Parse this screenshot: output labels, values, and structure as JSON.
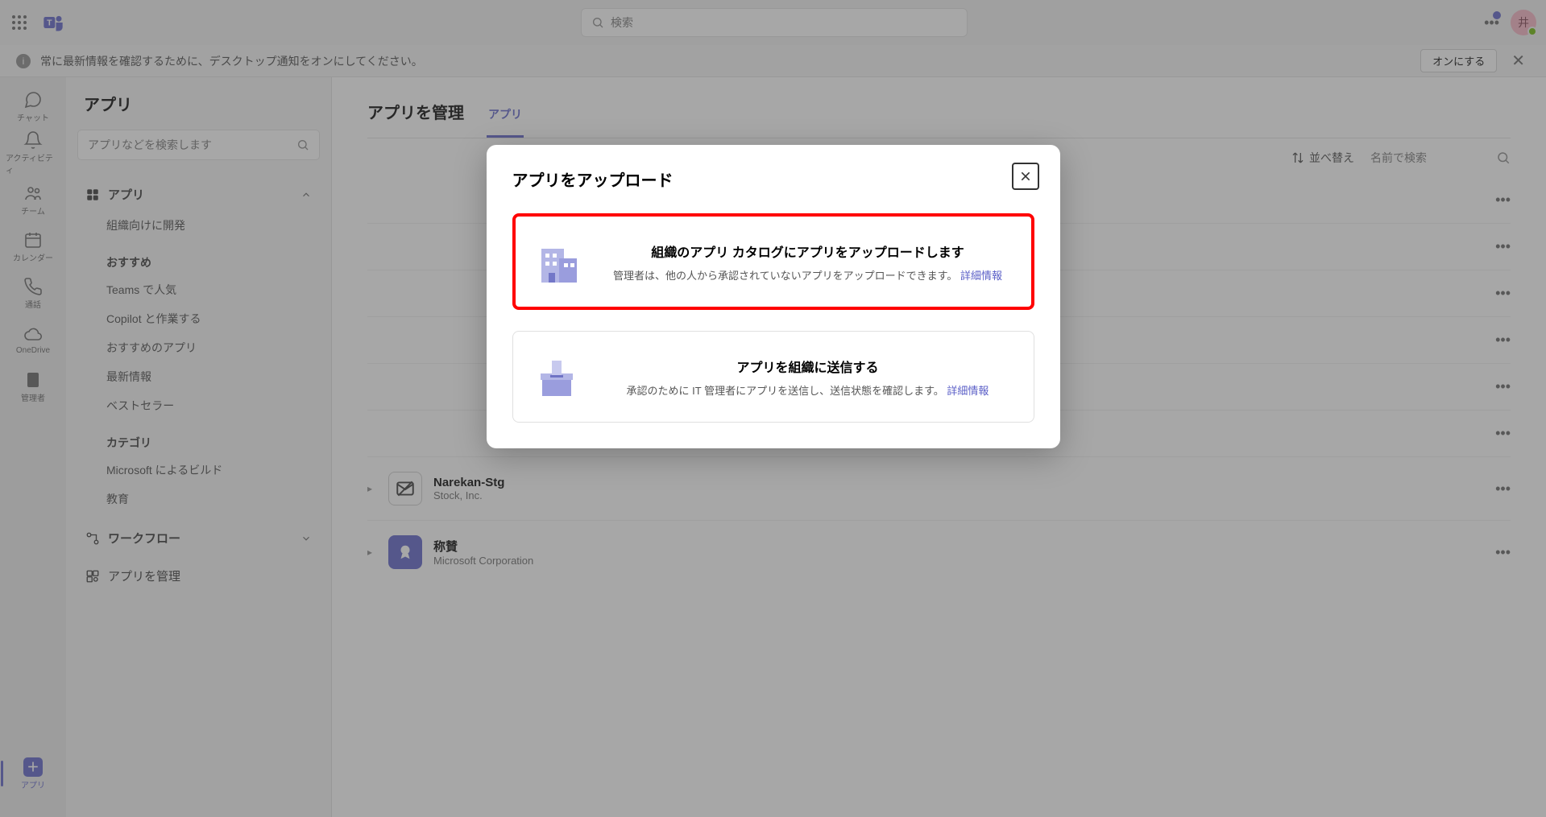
{
  "topbar": {
    "search_placeholder": "検索",
    "avatar_initial": "井"
  },
  "banner": {
    "text": "常に最新情報を確認するために、デスクトップ通知をオンにしてください。",
    "button": "オンにする"
  },
  "rail": {
    "items": [
      {
        "label": "チャット"
      },
      {
        "label": "アクティビティ"
      },
      {
        "label": "チーム"
      },
      {
        "label": "カレンダー"
      },
      {
        "label": "通話"
      },
      {
        "label": "OneDrive"
      },
      {
        "label": "管理者"
      },
      {
        "label": "アプリ"
      }
    ]
  },
  "sidepanel": {
    "title": "アプリ",
    "search_placeholder": "アプリなどを検索します",
    "group_apps": "アプリ",
    "dev_for_org": "組織向けに開発",
    "section_recommended": "おすすめ",
    "rec": [
      "Teams で人気",
      "Copilot と作業する",
      "おすすめのアプリ",
      "最新情報",
      "ベストセラー"
    ],
    "section_category": "カテゴリ",
    "cat": [
      "Microsoft によるビルド",
      "教育"
    ],
    "group_workflow": "ワークフロー",
    "manage_apps": "アプリを管理"
  },
  "content": {
    "title": "アプリを管理",
    "tab": "アプリ",
    "sort_label": "並べ替え",
    "filter_placeholder": "名前で検索",
    "apps": [
      {
        "name": "Narekan-Stg",
        "publisher": "Stock, Inc."
      },
      {
        "name": "称賛",
        "publisher": "Microsoft Corporation"
      }
    ]
  },
  "modal": {
    "title": "アプリをアップロード",
    "opt1_title": "組織のアプリ カタログにアプリをアップロードします",
    "opt1_desc": "管理者は、他の人から承認されていないアプリをアップロードできます。",
    "opt2_title": "アプリを組織に送信する",
    "opt2_desc": "承認のために IT 管理者にアプリを送信し、送信状態を確認します。",
    "link": "詳細情報"
  }
}
